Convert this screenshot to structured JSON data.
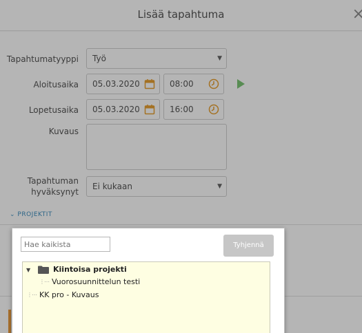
{
  "dialog": {
    "title": "Lisää tapahtuma",
    "close_glyph": "×"
  },
  "form": {
    "type": {
      "label": "Tapahtumatyyppi",
      "value": "Työ"
    },
    "start": {
      "label": "Aloitusaika",
      "date": "05.03.2020",
      "time": "08:00"
    },
    "end": {
      "label": "Lopetusaika",
      "date": "05.03.2020",
      "time": "16:00"
    },
    "description": {
      "label": "Kuvaus",
      "value": ""
    },
    "approvers": {
      "label_line1": "Tapahtuman",
      "label_line2": "hyväksynyt",
      "value": "Ei kukaan"
    },
    "projects_section": "PROJEKTIT"
  },
  "popup": {
    "search_placeholder": "Hae kaikista",
    "clear_label": "Tyhjennä",
    "tree": [
      {
        "label": "Kiintoisa projekti",
        "bold": true,
        "expanded": true,
        "icon": "folder-icon"
      },
      {
        "label": "Vuorosuunnittelun testi",
        "bold": false,
        "child": true
      },
      {
        "label": "KK pro - Kuvaus",
        "bold": false,
        "child": false
      }
    ]
  },
  "colors": {
    "accent": "#3f8fbf",
    "icon_orange": "#e8a030",
    "play_green": "#7cc576",
    "tree_bg": "#fefee2",
    "clear_bg": "#c6c6c6"
  }
}
